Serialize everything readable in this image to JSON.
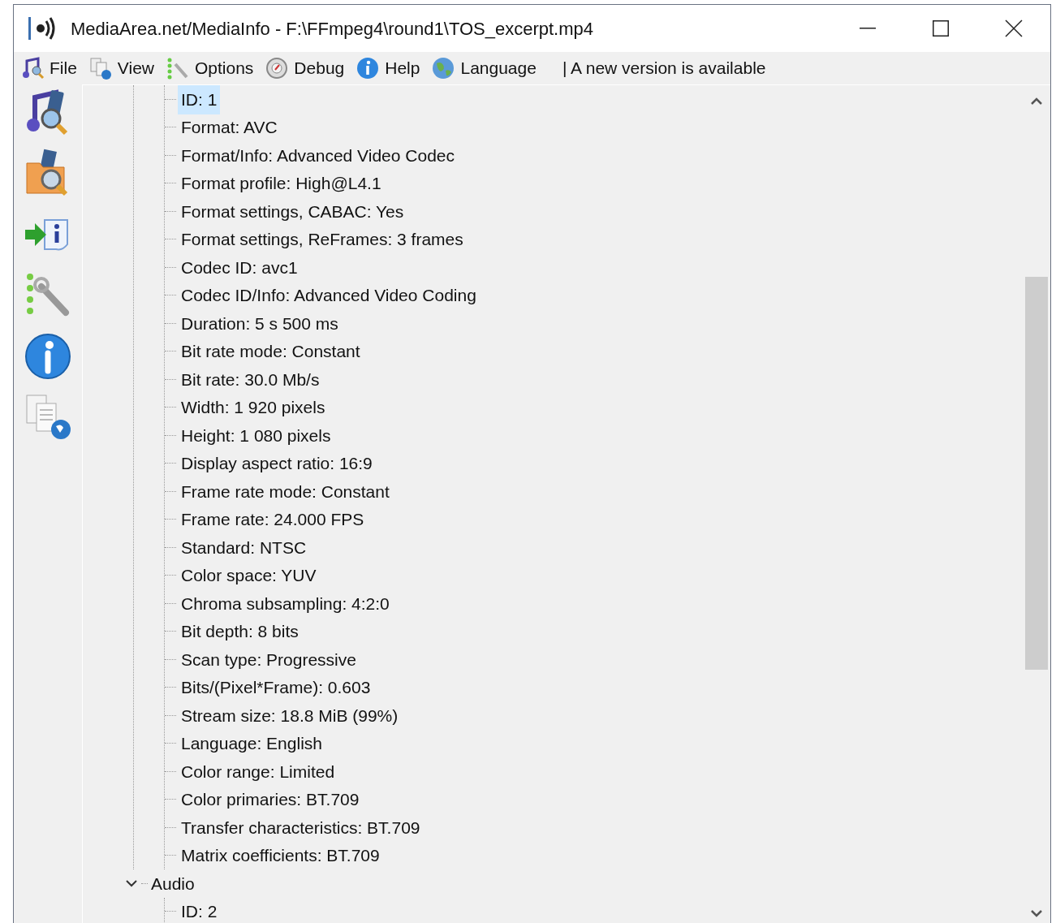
{
  "window": {
    "title": "MediaArea.net/MediaInfo - F:\\FFmpeg4\\round1\\TOS_excerpt.mp4"
  },
  "menu": [
    {
      "label": "File"
    },
    {
      "label": "View"
    },
    {
      "label": "Options"
    },
    {
      "label": "Debug"
    },
    {
      "label": "Help"
    },
    {
      "label": "Language"
    }
  ],
  "notice": "| A new version is available",
  "tree": [
    {
      "children": [
        {
          "label": "ID: 1",
          "selected": true
        },
        {
          "label": "Format: AVC",
          "selected": false
        },
        {
          "label": "Format/Info: Advanced Video Codec",
          "selected": false
        },
        {
          "label": "Format profile: High@L4.1",
          "selected": false
        },
        {
          "label": "Format settings, CABAC: Yes",
          "selected": false
        },
        {
          "label": "Format settings, ReFrames: 3 frames",
          "selected": false
        },
        {
          "label": "Codec ID: avc1",
          "selected": false
        },
        {
          "label": "Codec ID/Info: Advanced Video Coding",
          "selected": false
        },
        {
          "label": "Duration: 5 s 500 ms",
          "selected": false
        },
        {
          "label": "Bit rate mode: Constant",
          "selected": false
        },
        {
          "label": "Bit rate: 30.0 Mb/s",
          "selected": false
        },
        {
          "label": "Width: 1 920 pixels",
          "selected": false
        },
        {
          "label": "Height: 1 080 pixels",
          "selected": false
        },
        {
          "label": "Display aspect ratio: 16:9",
          "selected": false
        },
        {
          "label": "Frame rate mode: Constant",
          "selected": false
        },
        {
          "label": "Frame rate: 24.000 FPS",
          "selected": false
        },
        {
          "label": "Standard: NTSC",
          "selected": false
        },
        {
          "label": "Color space: YUV",
          "selected": false
        },
        {
          "label": "Chroma subsampling: 4:2:0",
          "selected": false
        },
        {
          "label": "Bit depth: 8 bits",
          "selected": false
        },
        {
          "label": "Scan type: Progressive",
          "selected": false
        },
        {
          "label": "Bits/(Pixel*Frame): 0.603",
          "selected": false
        },
        {
          "label": "Stream size: 18.8 MiB (99%)",
          "selected": false
        },
        {
          "label": "Language: English",
          "selected": false
        },
        {
          "label": "Color range: Limited",
          "selected": false
        },
        {
          "label": "Color primaries: BT.709",
          "selected": false
        },
        {
          "label": "Transfer characteristics: BT.709",
          "selected": false
        },
        {
          "label": "Matrix coefficients: BT.709",
          "selected": false
        }
      ]
    },
    {
      "label": "Audio",
      "expanded": true,
      "selected": false,
      "children": [
        {
          "label": "ID: 2",
          "selected": false
        }
      ]
    }
  ]
}
